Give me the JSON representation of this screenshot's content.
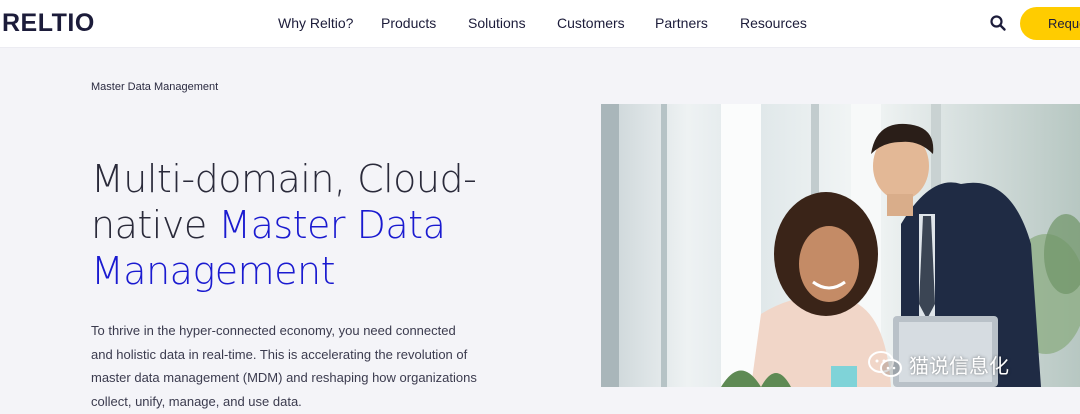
{
  "header": {
    "logo": "RELTIO",
    "nav": [
      "Why Reltio?",
      "Products",
      "Solutions",
      "Customers",
      "Partners",
      "Resources"
    ],
    "cta_label": "Reque"
  },
  "breadcrumb": "Master Data Management",
  "headline": {
    "line1": "Multi-domain, Cloud-",
    "line2_plain": "native ",
    "line2_accent": "Master Data",
    "line3_accent": "Management"
  },
  "lead": {
    "line1": "To thrive in the hyper-connected economy, you need connected",
    "line2": "and holistic data in real-time. This is accelerating the revolution of",
    "line3": "master data management (MDM) and reshaping how organizations",
    "line4": "collect, unify, manage, and use data."
  },
  "watermark": "猫说信息化",
  "colors": {
    "accent": "#1a1ad0",
    "cta": "#ffcc00",
    "background": "#f4f4f8"
  }
}
